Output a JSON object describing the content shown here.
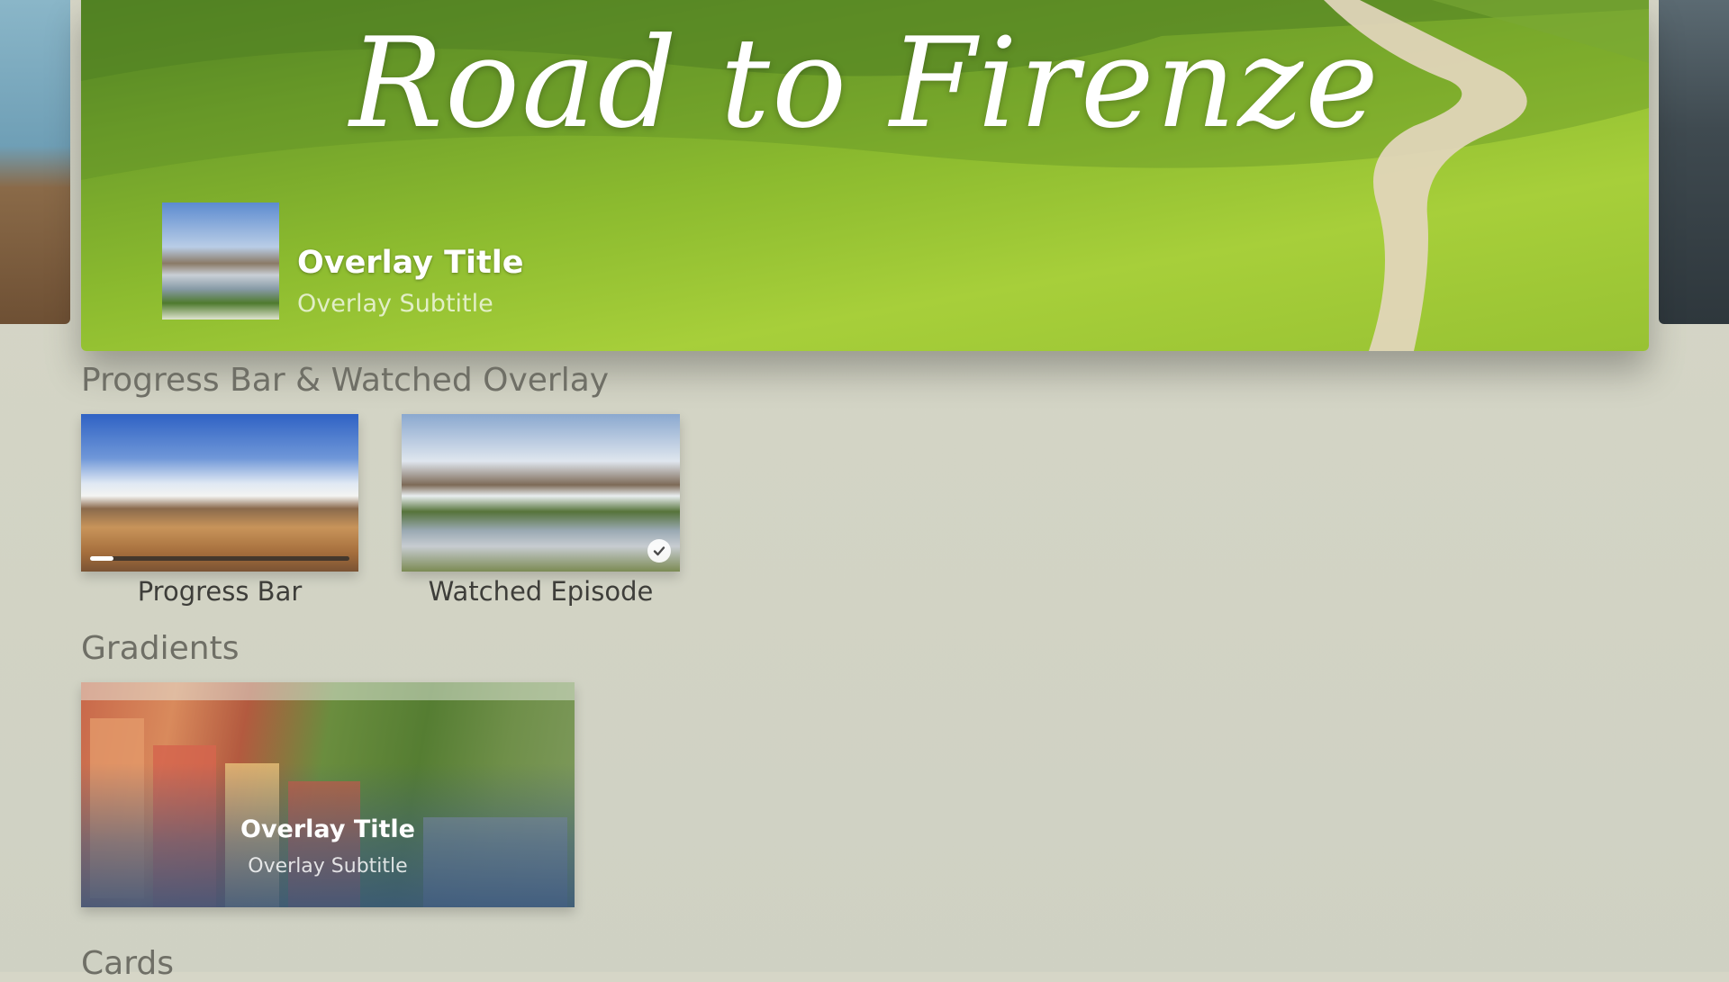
{
  "hero": {
    "title": "Road to Firenze",
    "overlay_title": "Overlay Title",
    "overlay_subtitle": "Overlay Subtitle"
  },
  "sections": {
    "progress": {
      "title": "Progress Bar & Watched Overlay",
      "items": [
        {
          "caption": "Progress Bar",
          "progress": 0.09
        },
        {
          "caption": "Watched Episode",
          "watched": true
        }
      ]
    },
    "gradients": {
      "title": "Gradients",
      "card": {
        "overlay_title": "Overlay Title",
        "overlay_subtitle": "Overlay Subtitle"
      }
    },
    "cards": {
      "title": "Cards"
    }
  },
  "icons": {
    "watched": "checkmark-icon"
  }
}
